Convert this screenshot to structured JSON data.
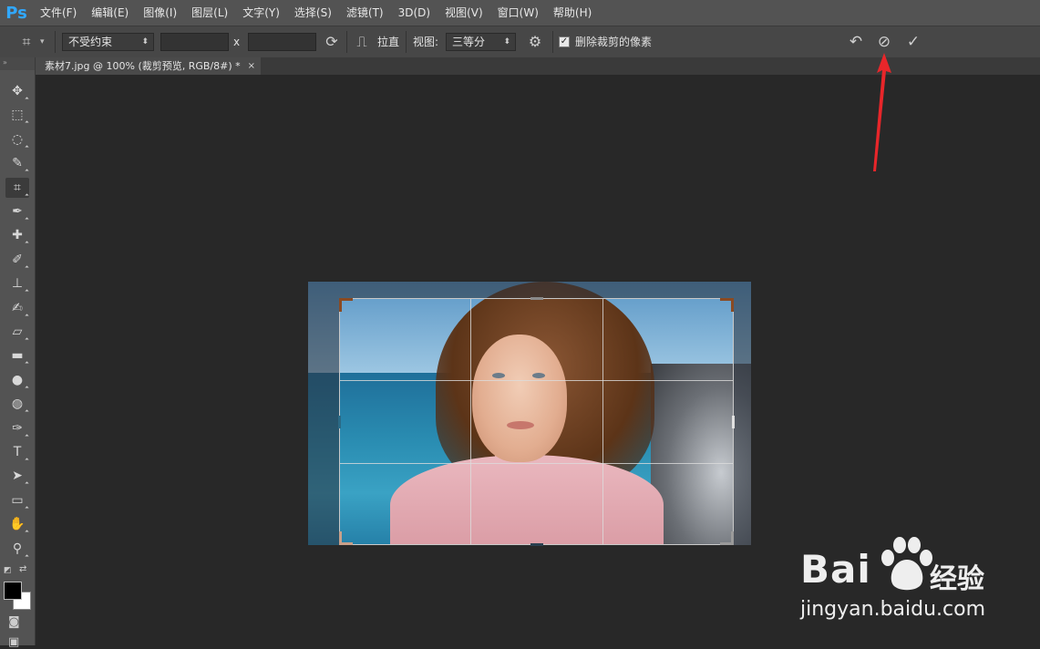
{
  "app": {
    "logo": "Ps",
    "menu": [
      "文件(F)",
      "编辑(E)",
      "图像(I)",
      "图层(L)",
      "文字(Y)",
      "选择(S)",
      "滤镜(T)",
      "3D(D)",
      "视图(V)",
      "窗口(W)",
      "帮助(H)"
    ]
  },
  "options_bar": {
    "tool_icon": "crop-icon",
    "ratio_dropdown": "不受约束",
    "width_value": "",
    "height_value": "",
    "x_separator": "x",
    "clear_icon": "rotate-swap-icon",
    "straighten_label": "拉直",
    "view_label": "视图:",
    "view_dropdown": "三等分",
    "settings_icon": "gear-icon",
    "delete_cropped_checked": true,
    "delete_cropped_label": "删除裁剪的像素",
    "reset_icon": "undo-icon",
    "cancel_icon": "cancel-circle-icon",
    "commit_icon": "checkmark-icon"
  },
  "document_tab": {
    "title": "素材7.jpg @ 100% (裁剪预览, RGB/8#) *",
    "close": "×"
  },
  "tools_header": "»",
  "tools": [
    {
      "name": "move-tool",
      "glyph": "✥"
    },
    {
      "name": "marquee-tool",
      "glyph": "⬚"
    },
    {
      "name": "lasso-tool",
      "glyph": "◌"
    },
    {
      "name": "quick-select-tool",
      "glyph": "✎"
    },
    {
      "name": "crop-tool",
      "glyph": "⌗",
      "active": true
    },
    {
      "name": "eyedropper-tool",
      "glyph": "✒"
    },
    {
      "name": "healing-tool",
      "glyph": "✚"
    },
    {
      "name": "brush-tool",
      "glyph": "✐"
    },
    {
      "name": "stamp-tool",
      "glyph": "⊥"
    },
    {
      "name": "history-brush-tool",
      "glyph": "✍"
    },
    {
      "name": "eraser-tool",
      "glyph": "▱"
    },
    {
      "name": "gradient-tool",
      "glyph": "▬"
    },
    {
      "name": "blur-tool",
      "glyph": "●"
    },
    {
      "name": "dodge-tool",
      "glyph": "◍"
    },
    {
      "name": "pen-tool",
      "glyph": "✑"
    },
    {
      "name": "type-tool",
      "glyph": "T"
    },
    {
      "name": "path-select-tool",
      "glyph": "➤"
    },
    {
      "name": "shape-tool",
      "glyph": "▭"
    },
    {
      "name": "hand-tool",
      "glyph": "✋"
    },
    {
      "name": "zoom-tool",
      "glyph": "⚲"
    }
  ],
  "colors": {
    "foreground": "#000000",
    "background": "#ffffff",
    "annotation_arrow": "#e8262a"
  },
  "watermark": {
    "brand": "Bai",
    "brand_suffix": "经验",
    "url": "jingyan.baidu.com"
  }
}
